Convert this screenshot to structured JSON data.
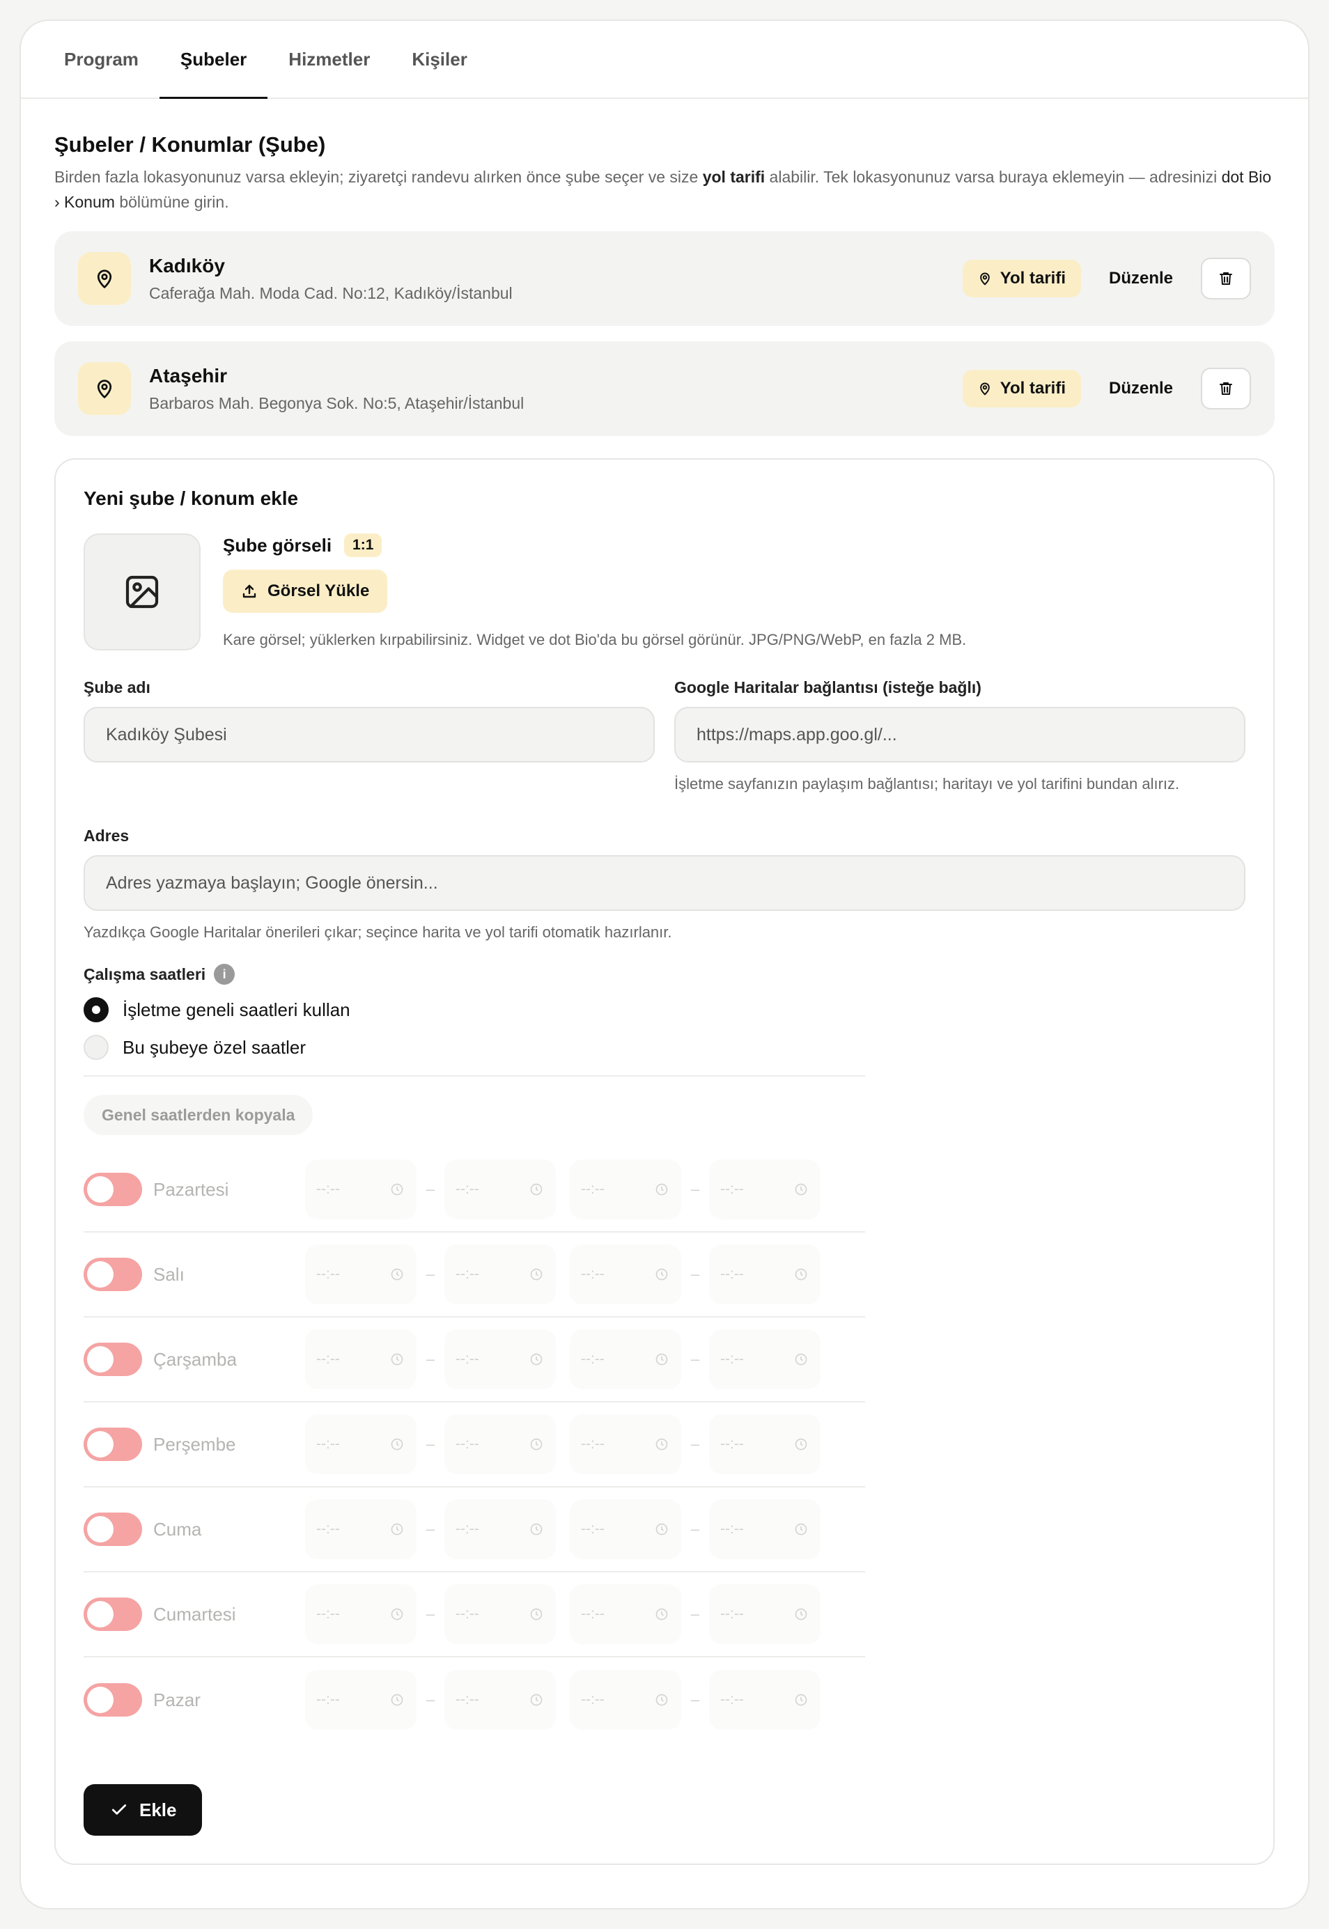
{
  "tabs": [
    {
      "label": "Program"
    },
    {
      "label": "Şubeler"
    },
    {
      "label": "Hizmetler"
    },
    {
      "label": "Kişiler"
    }
  ],
  "active_tab": "Şubeler",
  "section": {
    "title": "Şubeler / Konumlar (Şube)",
    "desc_part1": "Birden fazla lokasyonunuz varsa ekleyin; ziyaretçi randevu alırken önce şube seçer ve size ",
    "desc_bold": "yol tarifi",
    "desc_part2": " alabilir. Tek lokasyonunuz varsa buraya eklemeyin — adresinizi ",
    "desc_link": "dot Bio › Konum",
    "desc_part3": " bölümüne girin."
  },
  "branches": [
    {
      "name": "Kadıköy",
      "address": "Caferağa Mah. Moda Cad. No:12, Kadıköy/İstanbul",
      "route_label": "Yol tarifi",
      "edit_label": "Düzenle"
    },
    {
      "name": "Ataşehir",
      "address": "Barbaros Mah. Begonya Sok. No:5, Ataşehir/İstanbul",
      "route_label": "Yol tarifi",
      "edit_label": "Düzenle"
    }
  ],
  "form": {
    "title": "Yeni şube / konum ekle",
    "image_label": "Şube görseli",
    "image_ratio": "1:1",
    "upload_label": "Görsel Yükle",
    "image_hint": "Kare görsel; yüklerken kırpabilirsiniz. Widget ve dot Bio'da bu görsel görünür. JPG/PNG/WebP, en fazla 2 MB.",
    "name_label": "Şube adı",
    "name_placeholder": "Kadıköy Şubesi",
    "maps_label": "Google Haritalar bağlantısı (isteğe bağlı)",
    "maps_placeholder": "https://maps.app.goo.gl/...",
    "maps_hint": "İşletme sayfanızın paylaşım bağlantısı; haritayı ve yol tarifini bundan alırız.",
    "address_label": "Adres",
    "address_placeholder": "Adres yazmaya başlayın; Google önersin...",
    "address_hint": "Yazdıkça Google Haritalar önerileri çıkar; seçince harita ve yol tarifi otomatik hazırlanır.",
    "hours_label": "Çalışma saatleri",
    "hours_options": [
      {
        "label": "İşletme geneli saatleri kullan",
        "checked": true
      },
      {
        "label": "Bu şubeye özel saatler",
        "checked": false
      }
    ],
    "copy_label": "Genel saatlerden kopyala",
    "time_placeholder": "--:--",
    "days": [
      "Pazartesi",
      "Salı",
      "Çarşamba",
      "Perşembe",
      "Cuma",
      "Cumartesi",
      "Pazar"
    ],
    "submit_label": "Ekle"
  }
}
